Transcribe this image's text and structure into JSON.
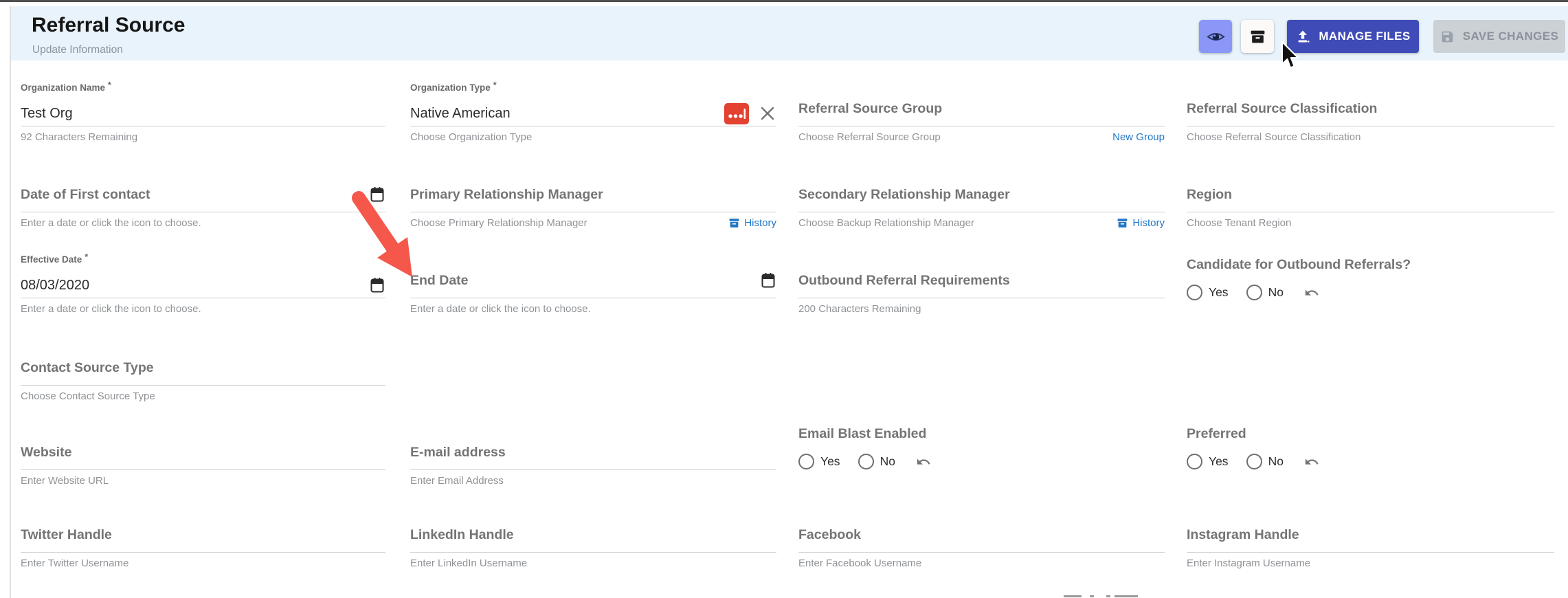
{
  "header": {
    "title": "Referral Source",
    "subtitle": "Update Information",
    "manage_files_label": "MANAGE FILES",
    "save_changes_label": "SAVE CHANGES"
  },
  "colors": {
    "header_bg": "#e9f3fb",
    "primary_button": "#3f4cb8",
    "icon_button_active": "#8b97f7",
    "disabled_button": "#ccd1d6",
    "link_blue": "#2277c8",
    "danger_red": "#e2422f",
    "annotation_arrow_red": "#f5574b"
  },
  "icons": [
    "eye-icon",
    "archive-icon",
    "upload-icon",
    "save-icon",
    "calendar-icon",
    "close-icon",
    "ellipsis-picker-icon",
    "history-box-icon",
    "undo-icon",
    "cursor-pointer",
    "annotation-arrow"
  ],
  "fields": {
    "organization_name": {
      "label": "Organization Name",
      "required": "*",
      "value": "Test Org",
      "helper": "92 Characters Remaining"
    },
    "organization_type": {
      "label": "Organization Type",
      "required": "*",
      "value": "Native American",
      "helper": "Choose Organization Type"
    },
    "referral_source_group": {
      "label": "Referral Source Group",
      "helper": "Choose Referral Source Group",
      "link": "New Group"
    },
    "referral_source_classification": {
      "label": "Referral Source Classification",
      "helper": "Choose Referral Source Classification"
    },
    "date_of_first_contact": {
      "label": "Date of First contact",
      "helper": "Enter a date or click the icon to choose."
    },
    "primary_relationship_manager": {
      "label": "Primary Relationship Manager",
      "helper": "Choose Primary Relationship Manager",
      "link": "History"
    },
    "secondary_relationship_manager": {
      "label": "Secondary Relationship Manager",
      "helper": "Choose Backup Relationship Manager",
      "link": "History"
    },
    "region": {
      "label": "Region",
      "helper": "Choose Tenant Region"
    },
    "effective_date": {
      "label": "Effective Date",
      "required": "*",
      "value": "08/03/2020",
      "helper": "Enter a date or click the icon to choose."
    },
    "end_date": {
      "label": "End Date",
      "helper": "Enter a date or click the icon to choose."
    },
    "outbound_referral_requirements": {
      "label": "Outbound Referral Requirements",
      "helper": "200 Characters Remaining"
    },
    "candidate_for_outbound_referrals": {
      "label": "Candidate for Outbound Referrals?",
      "yes": "Yes",
      "no": "No"
    },
    "contact_source_type": {
      "label": "Contact Source Type",
      "helper": "Choose Contact Source Type"
    },
    "website": {
      "label": "Website",
      "helper": "Enter Website URL"
    },
    "email_address": {
      "label": "E-mail address",
      "helper": "Enter Email Address"
    },
    "email_blast_enabled": {
      "label": "Email Blast Enabled",
      "yes": "Yes",
      "no": "No"
    },
    "preferred": {
      "label": "Preferred",
      "yes": "Yes",
      "no": "No"
    },
    "twitter_handle": {
      "label": "Twitter Handle",
      "helper": "Enter Twitter Username"
    },
    "linkedin_handle": {
      "label": "LinkedIn Handle",
      "helper": "Enter LinkedIn Username"
    },
    "facebook": {
      "label": "Facebook",
      "helper": "Enter Facebook Username"
    },
    "instagram_handle": {
      "label": "Instagram Handle",
      "helper": "Enter Instagram Username"
    }
  }
}
